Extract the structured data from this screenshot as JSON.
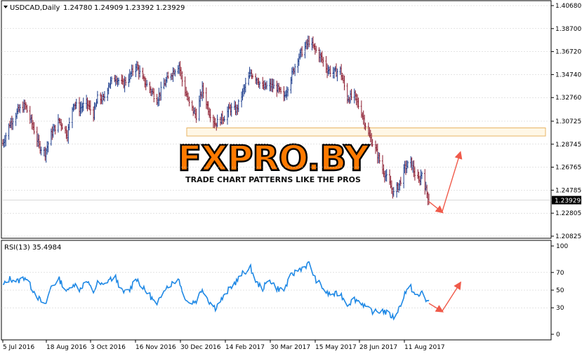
{
  "header": {
    "symbol_label": "USDCAD,Daily",
    "ohlc": [
      "1.24780",
      "1.24909",
      "1.23392",
      "1.23929"
    ]
  },
  "rsi_label": "RSI(13) 35.4984",
  "watermark": {
    "brand": "FXPRO.BY",
    "tagline": "TRADE CHART PATTERNS LIKE THE PROS"
  },
  "colors": {
    "bull": "#1a3b8c",
    "bear": "#8b1a2e",
    "rsi_line": "#1e88e5",
    "arrow": "#f05a4a",
    "zone_fill": "#fff7e6",
    "zone_border": "#e8b464",
    "grid": "#c8c8c8",
    "axis": "#000000"
  },
  "chart_data": [
    {
      "type": "candlestick",
      "symbol": "USDCAD",
      "timeframe": "Daily",
      "y_ticks": [
        "1.40680",
        "1.38700",
        "1.36720",
        "1.34740",
        "1.32760",
        "1.30725",
        "1.28745",
        "1.26765",
        "1.24785",
        "1.22805",
        "1.20825"
      ],
      "ylim": [
        1.20825,
        1.4068
      ],
      "current_price": "1.23929",
      "x_ticks": [
        "5 Jul 2016",
        "18 Aug 2016",
        "3 Oct 2016",
        "16 Nov 2016",
        "30 Dec 2016",
        "14 Feb 2017",
        "30 Mar 2017",
        "15 May 2017",
        "28 Jun 2017",
        "11 Aug 2017"
      ],
      "xlim": [
        "2016-07-05",
        "2017-09-01"
      ],
      "close_path": [
        [
          "2016-07-05",
          1.288
        ],
        [
          "2016-07-12",
          1.305
        ],
        [
          "2016-07-20",
          1.316
        ],
        [
          "2016-07-27",
          1.321
        ],
        [
          "2016-08-03",
          1.305
        ],
        [
          "2016-08-10",
          1.286
        ],
        [
          "2016-08-16",
          1.28
        ],
        [
          "2016-08-22",
          1.296
        ],
        [
          "2016-08-30",
          1.308
        ],
        [
          "2016-09-07",
          1.296
        ],
        [
          "2016-09-13",
          1.323
        ],
        [
          "2016-09-19",
          1.318
        ],
        [
          "2016-09-26",
          1.323
        ],
        [
          "2016-10-03",
          1.313
        ],
        [
          "2016-10-07",
          1.327
        ],
        [
          "2016-10-13",
          1.326
        ],
        [
          "2016-10-18",
          1.339
        ],
        [
          "2016-10-25",
          1.345
        ],
        [
          "2016-11-01",
          1.339
        ],
        [
          "2016-11-08",
          1.346
        ],
        [
          "2016-11-14",
          1.356
        ],
        [
          "2016-11-21",
          1.343
        ],
        [
          "2016-11-28",
          1.335
        ],
        [
          "2016-12-05",
          1.326
        ],
        [
          "2016-12-12",
          1.339
        ],
        [
          "2016-12-19",
          1.348
        ],
        [
          "2016-12-27",
          1.356
        ],
        [
          "2016-12-30",
          1.342
        ],
        [
          "2017-01-06",
          1.322
        ],
        [
          "2017-01-13",
          1.312
        ],
        [
          "2017-01-19",
          1.335
        ],
        [
          "2017-01-26",
          1.315
        ],
        [
          "2017-02-01",
          1.305
        ],
        [
          "2017-02-06",
          1.309
        ],
        [
          "2017-02-10",
          1.311
        ],
        [
          "2017-02-15",
          1.318
        ],
        [
          "2017-02-22",
          1.317
        ],
        [
          "2017-03-01",
          1.334
        ],
        [
          "2017-03-08",
          1.349
        ],
        [
          "2017-03-14",
          1.344
        ],
        [
          "2017-03-20",
          1.336
        ],
        [
          "2017-03-27",
          1.338
        ],
        [
          "2017-04-03",
          1.336
        ],
        [
          "2017-04-10",
          1.327
        ],
        [
          "2017-04-17",
          1.345
        ],
        [
          "2017-04-24",
          1.362
        ],
        [
          "2017-05-01",
          1.371
        ],
        [
          "2017-05-05",
          1.376
        ],
        [
          "2017-05-11",
          1.369
        ],
        [
          "2017-05-17",
          1.362
        ],
        [
          "2017-05-23",
          1.352
        ],
        [
          "2017-05-29",
          1.349
        ],
        [
          "2017-06-05",
          1.351
        ],
        [
          "2017-06-12",
          1.327
        ],
        [
          "2017-06-19",
          1.329
        ],
        [
          "2017-06-26",
          1.315
        ],
        [
          "2017-07-03",
          1.296
        ],
        [
          "2017-07-10",
          1.283
        ],
        [
          "2017-07-17",
          1.266
        ],
        [
          "2017-07-24",
          1.253
        ],
        [
          "2017-07-28",
          1.245
        ],
        [
          "2017-08-03",
          1.254
        ],
        [
          "2017-08-08",
          1.267
        ],
        [
          "2017-08-14",
          1.272
        ],
        [
          "2017-08-18",
          1.262
        ],
        [
          "2017-08-22",
          1.255
        ],
        [
          "2017-08-25",
          1.263
        ],
        [
          "2017-08-29",
          1.248
        ],
        [
          "2017-09-01",
          1.239
        ]
      ],
      "resistance_zone": [
        1.2945,
        1.3015
      ],
      "projection_arrows": [
        {
          "from": [
            "2017-09-01",
            1.238
          ],
          "to": [
            "2017-09-14",
            1.229
          ]
        },
        {
          "from": [
            "2017-09-14",
            1.229
          ],
          "to": [
            "2017-10-02",
            1.28
          ]
        }
      ]
    },
    {
      "type": "line",
      "title": "RSI(13) 35.4984",
      "y_ticks": [
        "100",
        "70",
        "50",
        "30",
        "0"
      ],
      "ylim": [
        0,
        100
      ],
      "x_ticks": [
        "5 Jul 2016",
        "18 Aug 2016",
        "3 Oct 2016",
        "16 Nov 2016",
        "30 Dec 2016",
        "14 Feb 2017",
        "30 Mar 2017",
        "15 May 2017",
        "28 Jun 2017",
        "11 Aug 2017"
      ],
      "series": [
        {
          "values": [
            [
              "2016-07-05",
              55
            ],
            [
              "2016-07-12",
              63
            ],
            [
              "2016-07-20",
              60
            ],
            [
              "2016-07-27",
              65
            ],
            [
              "2016-08-03",
              52
            ],
            [
              "2016-08-10",
              40
            ],
            [
              "2016-08-16",
              32
            ],
            [
              "2016-08-22",
              54
            ],
            [
              "2016-08-30",
              62
            ],
            [
              "2016-09-07",
              48
            ],
            [
              "2016-09-13",
              58
            ],
            [
              "2016-09-19",
              51
            ],
            [
              "2016-09-26",
              60
            ],
            [
              "2016-10-03",
              48
            ],
            [
              "2016-10-07",
              58
            ],
            [
              "2016-10-13",
              55
            ],
            [
              "2016-10-18",
              62
            ],
            [
              "2016-10-25",
              64
            ],
            [
              "2016-11-01",
              47
            ],
            [
              "2016-11-08",
              50
            ],
            [
              "2016-11-14",
              65
            ],
            [
              "2016-11-21",
              52
            ],
            [
              "2016-11-28",
              44
            ],
            [
              "2016-12-05",
              32
            ],
            [
              "2016-12-12",
              52
            ],
            [
              "2016-12-19",
              57
            ],
            [
              "2016-12-27",
              63
            ],
            [
              "2016-12-30",
              48
            ],
            [
              "2017-01-06",
              35
            ],
            [
              "2017-01-13",
              38
            ],
            [
              "2017-01-19",
              52
            ],
            [
              "2017-01-26",
              37
            ],
            [
              "2017-02-01",
              30
            ],
            [
              "2017-02-06",
              38
            ],
            [
              "2017-02-10",
              43
            ],
            [
              "2017-02-15",
              52
            ],
            [
              "2017-02-22",
              60
            ],
            [
              "2017-03-01",
              70
            ],
            [
              "2017-03-08",
              75
            ],
            [
              "2017-03-14",
              58
            ],
            [
              "2017-03-20",
              52
            ],
            [
              "2017-03-27",
              62
            ],
            [
              "2017-04-03",
              52
            ],
            [
              "2017-04-10",
              50
            ],
            [
              "2017-04-17",
              66
            ],
            [
              "2017-04-24",
              73
            ],
            [
              "2017-05-01",
              77
            ],
            [
              "2017-05-05",
              80
            ],
            [
              "2017-05-11",
              63
            ],
            [
              "2017-05-17",
              55
            ],
            [
              "2017-05-23",
              46
            ],
            [
              "2017-05-29",
              45
            ],
            [
              "2017-06-05",
              46
            ],
            [
              "2017-06-12",
              34
            ],
            [
              "2017-06-19",
              40
            ],
            [
              "2017-06-26",
              36
            ],
            [
              "2017-07-03",
              28
            ],
            [
              "2017-07-10",
              25
            ],
            [
              "2017-07-17",
              27
            ],
            [
              "2017-07-24",
              22
            ],
            [
              "2017-07-28",
              19
            ],
            [
              "2017-08-03",
              31
            ],
            [
              "2017-08-08",
              47
            ],
            [
              "2017-08-14",
              53
            ],
            [
              "2017-08-18",
              45
            ],
            [
              "2017-08-22",
              42
            ],
            [
              "2017-08-25",
              49
            ],
            [
              "2017-08-29",
              39
            ],
            [
              "2017-09-01",
              35.5
            ]
          ]
        }
      ],
      "projection_arrows": [
        {
          "from": [
            "2017-09-01",
            35
          ],
          "to": [
            "2017-09-14",
            26
          ]
        },
        {
          "from": [
            "2017-09-14",
            26
          ],
          "to": [
            "2017-10-02",
            58
          ]
        }
      ]
    }
  ]
}
